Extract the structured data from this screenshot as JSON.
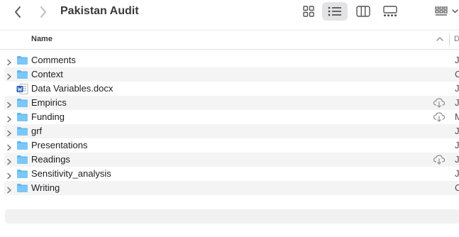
{
  "window": {
    "title": "Pakistan Audit"
  },
  "toolbar": {
    "back_icon": "chevron-left-icon",
    "forward_icon": "chevron-right-icon",
    "views": [
      "icon-view",
      "list-view",
      "column-view",
      "gallery-view"
    ],
    "active_view": "list-view",
    "group_icon": "group-icon"
  },
  "columns": {
    "name": "Name",
    "date": "D"
  },
  "rows": [
    {
      "name": "Comments",
      "kind": "folder",
      "cloud": false,
      "date": "J"
    },
    {
      "name": "Context",
      "kind": "folder",
      "cloud": false,
      "date": "C"
    },
    {
      "name": "Data Variables.docx",
      "kind": "word-doc",
      "cloud": false,
      "date": "J"
    },
    {
      "name": "Empirics",
      "kind": "folder",
      "cloud": true,
      "date": "J"
    },
    {
      "name": "Funding",
      "kind": "folder",
      "cloud": true,
      "date": "M"
    },
    {
      "name": "grf",
      "kind": "folder",
      "cloud": false,
      "date": "J"
    },
    {
      "name": "Presentations",
      "kind": "folder",
      "cloud": false,
      "date": "J"
    },
    {
      "name": "Readings",
      "kind": "folder",
      "cloud": true,
      "date": "J"
    },
    {
      "name": "Sensitivity_analysis",
      "kind": "folder",
      "cloud": false,
      "date": "J"
    },
    {
      "name": "Writing",
      "kind": "folder",
      "cloud": false,
      "date": "C"
    }
  ],
  "colors": {
    "folder": "#5fb8f0",
    "folder_tab": "#7cc7f5",
    "word": "#2b5fb4",
    "active_view_bg": "#e3e3e5"
  }
}
